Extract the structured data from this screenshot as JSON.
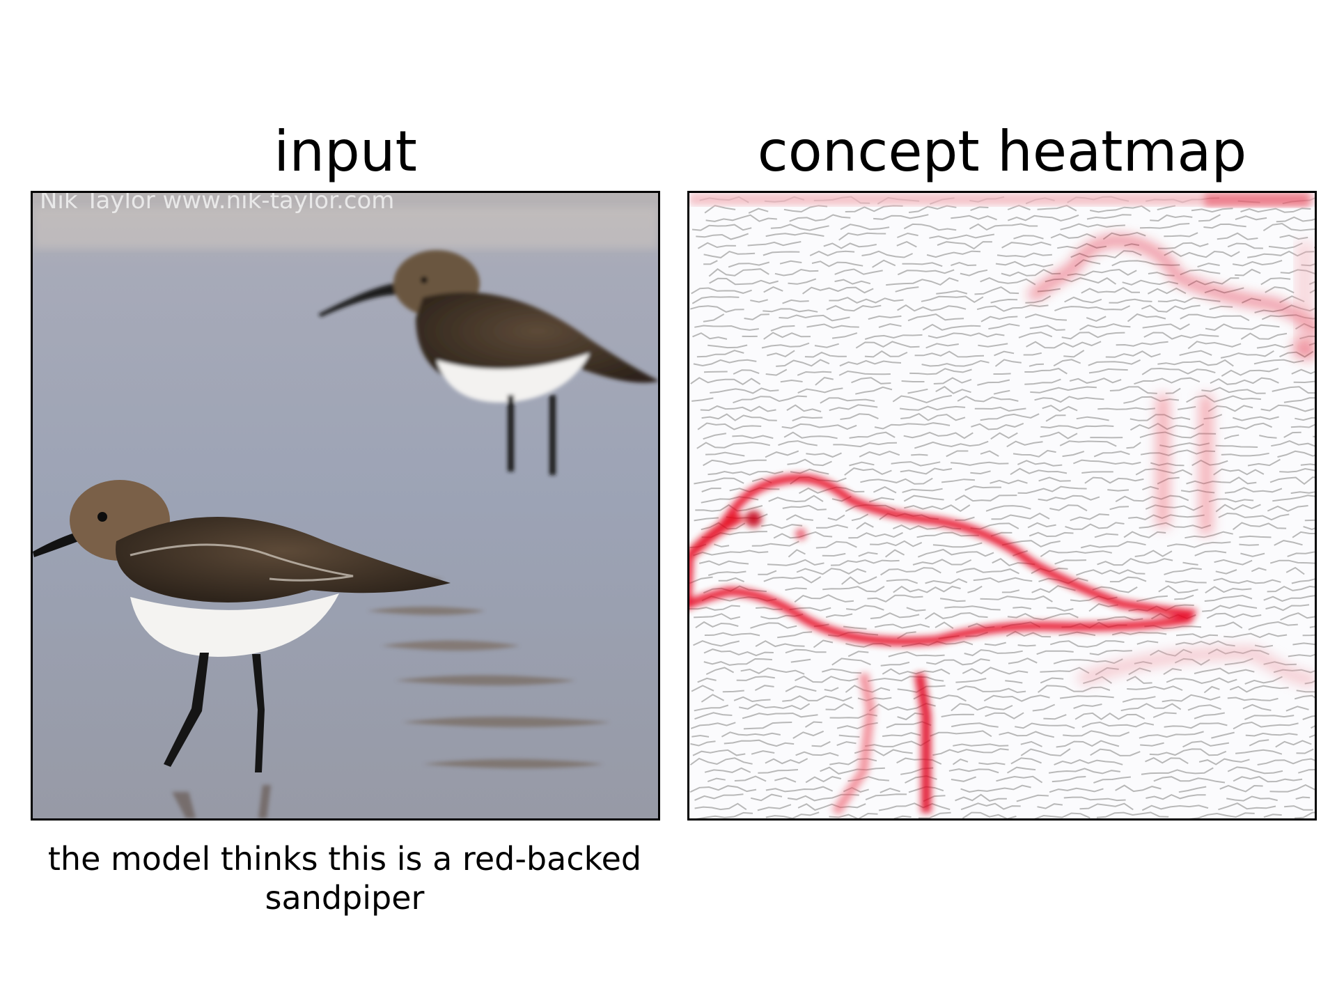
{
  "panels": {
    "input": {
      "title": "input"
    },
    "heatmap": {
      "title": "concept heatmap"
    }
  },
  "caption": "the model thinks this is a red-backed sandpiper",
  "image_watermark": "Nik Taylor  www.nik-taylor.com",
  "colors": {
    "water": "#9ea5b6",
    "heat": "#e0001a",
    "edge": "#b8b8b8",
    "heat_background": "#fbfbfd"
  }
}
